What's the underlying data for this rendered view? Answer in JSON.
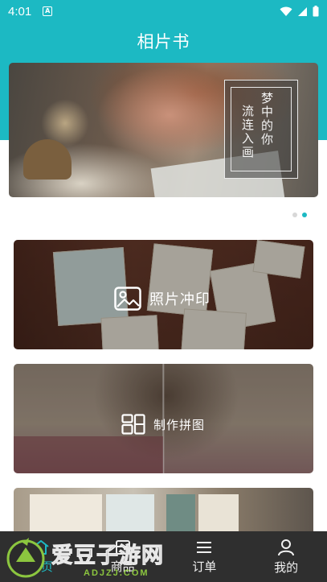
{
  "status_bar": {
    "time": "4:01",
    "notification_badge": "A",
    "icons": [
      "wifi-icon",
      "signal-icon",
      "battery-icon"
    ]
  },
  "header": {
    "title": "相片书",
    "background_color": "#1cb9c3"
  },
  "banner": {
    "poem_line_1": "梦中的你",
    "poem_line_2": "流连入画",
    "slide_count": 2,
    "active_slide": 2
  },
  "cards": [
    {
      "label": "照片冲印",
      "icon": "image-icon"
    },
    {
      "label": "制作拼图",
      "icon": "collage-icon"
    }
  ],
  "bottom_nav": [
    {
      "label": "首页",
      "icon": "home-icon",
      "active": true
    },
    {
      "label": "商品",
      "icon": "goods-icon",
      "active": false
    },
    {
      "label": "订单",
      "icon": "list-icon",
      "active": false
    },
    {
      "label": "我的",
      "icon": "user-icon",
      "active": false
    }
  ],
  "watermark": {
    "text": "爱豆子游网",
    "domain": "ADJZJ.COM"
  }
}
